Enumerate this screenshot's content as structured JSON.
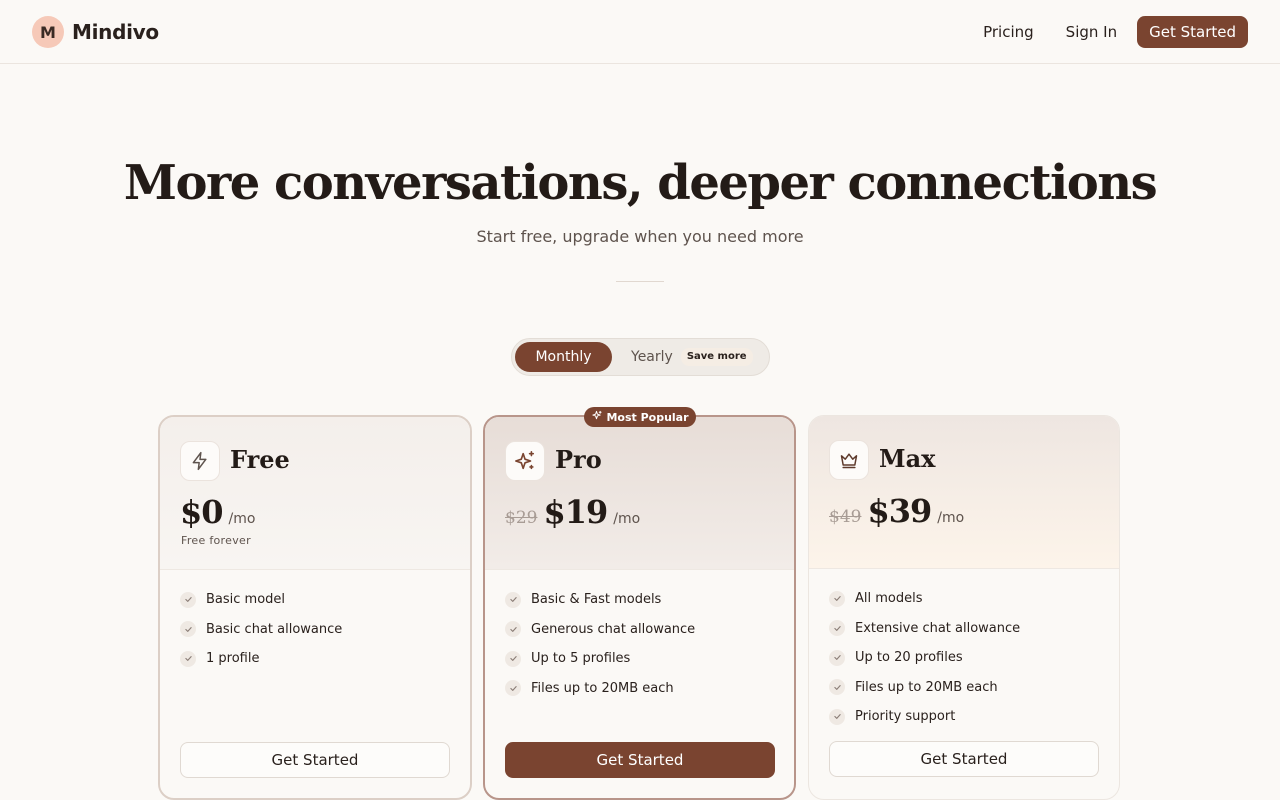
{
  "brand": {
    "logo_letter": "M",
    "name": "Mindivo"
  },
  "nav": {
    "pricing": "Pricing",
    "sign_in": "Sign In",
    "get_started": "Get Started"
  },
  "hero": {
    "title": "More conversations, deeper connections",
    "subtitle": "Start free, upgrade when you need more"
  },
  "billing_toggle": {
    "monthly": "Monthly",
    "yearly": "Yearly",
    "save_badge": "Save more",
    "selected": "Monthly"
  },
  "popular_badge": "Most Popular",
  "plans": [
    {
      "name": "Free",
      "icon": "bolt-icon",
      "old_price": "",
      "price": "$0",
      "per": "/mo",
      "note": "Free forever",
      "features": [
        "Basic model",
        "Basic chat allowance",
        "1 profile"
      ],
      "cta": "Get Started"
    },
    {
      "name": "Pro",
      "icon": "sparkle-icon",
      "old_price": "$29",
      "price": "$19",
      "per": "/mo",
      "note": "",
      "features": [
        "Basic & Fast models",
        "Generous chat allowance",
        "Up to 5 profiles",
        "Files up to 20MB each"
      ],
      "cta": "Get Started"
    },
    {
      "name": "Max",
      "icon": "crown-icon",
      "old_price": "$49",
      "price": "$39",
      "per": "/mo",
      "note": "",
      "features": [
        "All models",
        "Extensive chat allowance",
        "Up to 20 profiles",
        "Files up to 20MB each",
        "Priority support"
      ],
      "cta": "Get Started"
    }
  ],
  "colors": {
    "accent": "#7a4430",
    "background": "#fbf9f6",
    "logo_bg": "#f6c9b8"
  }
}
